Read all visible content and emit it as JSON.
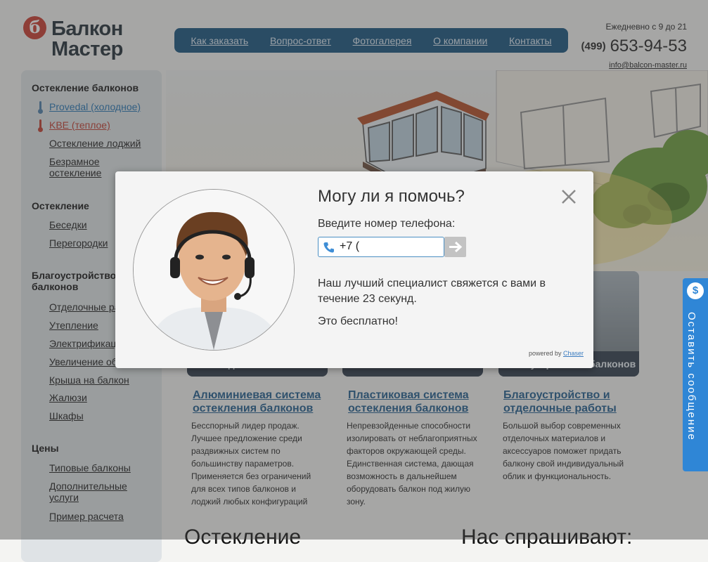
{
  "header": {
    "logo_mark": "б",
    "logo_line1": "Балкон",
    "logo_line2": "Мастер",
    "nav": [
      "Как заказать",
      "Вопрос-ответ",
      "Фотогалерея",
      "О компании",
      "Контакты"
    ],
    "hours": "Ежедневно с 9 до 21",
    "phone_code": "(499)",
    "phone_number": "653-94-53",
    "email": "info@balcon-master.ru"
  },
  "sidebar": {
    "section1": "Остекление балконов",
    "item_provedal": "Provedal (холодное)",
    "item_kbe": "KBE (теплое)",
    "item_loggia": "Остекление лоджий",
    "item_frameless": "Безрамное остекление",
    "section2": "Остекление",
    "item_gazebo": "Беседки",
    "item_partitions": "Перегородки",
    "section3": "Благоустройство балконов",
    "item_finishing": "Отделочные работы",
    "item_insulation": "Утепление",
    "item_electric": "Электрификация",
    "item_extension": "Увеличение объема",
    "item_roof": "Крыша на балкон",
    "item_blinds": "Жалюзи",
    "item_cabinets": "Шкафы",
    "section4": "Цены",
    "item_typical": "Типовые балконы",
    "item_extra": "Дополнительные услуги",
    "item_example": "Пример расчета"
  },
  "cards": [
    {
      "band": "Холодное остекление",
      "title": "Алюминиевая система остекления балконов",
      "desc": "Бесспорный лидер продаж. Лучшее предложение среди раздвижных систем по большинству параметров. Применяется без ограничений для всех типов балконов и лоджий любых конфигураций"
    },
    {
      "band": "Теплое остекление",
      "title": "Пластиковая система остекления балконов",
      "desc": "Непревзойденные способности изолировать от неблагоприятных факторов окружающей среды. Единственная система, дающая возможность в дальнейшем оборудовать балкон под жилую зону."
    },
    {
      "band": "Благоустройство балконов",
      "title": "Благоустройство и отделочные работы",
      "desc": "Большой выбор современных отделочных материалов и аксессуаров поможет придать балкону свой индивидуальный облик и функциональность."
    }
  ],
  "bottom": {
    "left_heading": "Остекление",
    "right_heading": "Нас спрашивают:"
  },
  "modal": {
    "title": "Могу ли я помочь?",
    "label": "Введите номер телефона:",
    "phone_value": "+7 (",
    "text1": "Наш лучший специалист свяжется с вами в течение 23 секунд.",
    "text2": "Это бесплатно!",
    "powered_by": "powered by",
    "powered_link": "Chaser"
  },
  "side_tab": {
    "label": "Оставить сообщение",
    "icon": "dollar-chat-icon"
  },
  "colors": {
    "nav_bg": "#13507d",
    "logo_red": "#c8372b",
    "link_blue": "#1d5a8c",
    "side_tab_blue": "#2f86d6"
  }
}
